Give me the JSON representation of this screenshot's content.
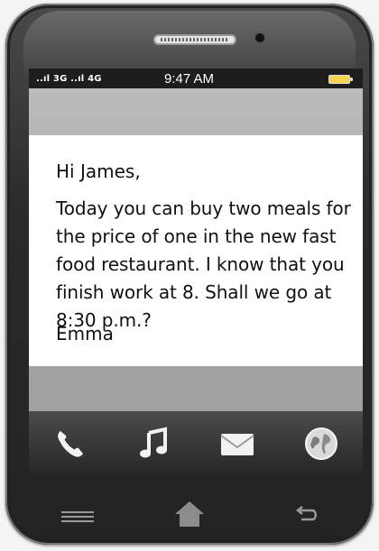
{
  "status_bar": {
    "signal": "..ıl 3G ..ıl 4G",
    "time": "9:47 AM",
    "battery_icon": "battery-icon"
  },
  "message": {
    "greeting": "Hi James,",
    "body": "Today you can buy two meals for the price of one in the new fast food restaurant. I know that you finish work at 8. Shall we go at 8:30 p.m.?",
    "signature": "Emma"
  },
  "dock": {
    "icons": [
      "phone-icon",
      "music-icon",
      "mail-icon",
      "browser-globe-icon"
    ]
  },
  "hardware": {
    "buttons": [
      "menu-icon",
      "home-icon",
      "back-icon"
    ]
  },
  "colors": {
    "status_bar": "#1d1d1d",
    "battery": "#f4d34f",
    "message_background": "#ffffff",
    "dock": "#2f2f2f"
  }
}
